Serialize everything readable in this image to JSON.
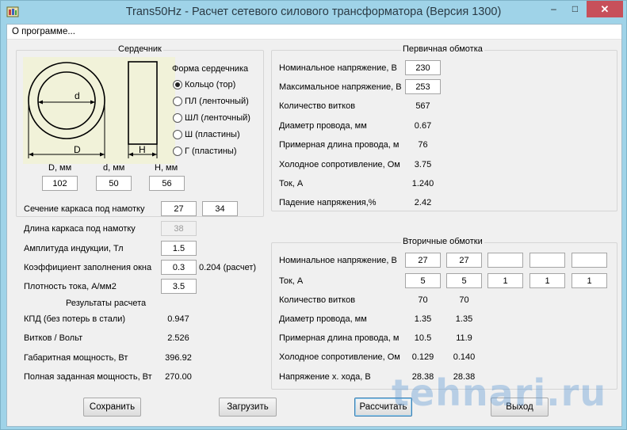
{
  "window": {
    "title": "Trans50Hz - Расчет сетевого силового трансформатора (Версия 1300)",
    "min": "–",
    "max": "□",
    "close": "✕"
  },
  "menu": {
    "about": "О программе..."
  },
  "core": {
    "group_title": "Сердечник",
    "shape_title": "Форма сердечника",
    "shapes": [
      "Кольцо  (тор)",
      "ПЛ  (ленточный)",
      "ШЛ  (ленточный)",
      "Ш  (пластины)",
      "Г (пластины)"
    ],
    "selected_shape": 0,
    "diagram": {
      "d": "d",
      "D": "D",
      "H": "H"
    },
    "dims": {
      "D_label": "D, мм",
      "d_label": "d, мм",
      "H_label": "H, мм",
      "D": "102",
      "d": "50",
      "H": "56"
    }
  },
  "params": {
    "section_label": "Сечение каркаса под намотку",
    "section1": "27",
    "section2": "34",
    "length_label": "Длина каркаса под намотку",
    "length": "38",
    "induction_label": "Амплитуда индукции, Тл",
    "induction": "1.5",
    "fill_label": "Коэффициент заполнения окна",
    "fill": "0.3",
    "fill_calc": "0.204 (расчет)",
    "density_label": "Плотность тока, А/мм2",
    "density": "3.5"
  },
  "results": {
    "title": "Результаты расчета",
    "rows": [
      {
        "label": "КПД (без потерь в стали)",
        "value": "0.947"
      },
      {
        "label": "Витков / Вольт",
        "value": "2.526"
      },
      {
        "label": "Габаритная мощность, Вт",
        "value": "396.92"
      },
      {
        "label": "Полная заданная мощность, Вт",
        "value": "270.00"
      }
    ]
  },
  "primary": {
    "title": "Первичная обмотка",
    "nominal_label": "Номинальное напряжение, В",
    "nominal": "230",
    "max_label": "Максимальное напряжение, В",
    "max": "253",
    "rows": [
      {
        "label": "Количество витков",
        "value": "567"
      },
      {
        "label": "Диаметр провода, мм",
        "value": "0.67"
      },
      {
        "label": "Примерная длина провода, м",
        "value": "76"
      },
      {
        "label": "Холодное сопротивление, Ом",
        "value": "3.75"
      },
      {
        "label": "Ток, А",
        "value": "1.240"
      },
      {
        "label": "Падение напряжения,%",
        "value": "2.42"
      }
    ]
  },
  "secondary": {
    "title": "Вторичные обмотки",
    "voltage_label": "Номинальное напряжение, В",
    "voltages": [
      "27",
      "27",
      "",
      "",
      ""
    ],
    "current_label": "Ток, А",
    "currents": [
      "5",
      "5",
      "1",
      "1",
      "1"
    ],
    "rows": [
      {
        "label": "Количество витков",
        "values": [
          "70",
          "70"
        ]
      },
      {
        "label": "Диаметр провода, мм",
        "values": [
          "1.35",
          "1.35"
        ]
      },
      {
        "label": "Примерная длина провода, м",
        "values": [
          "10.5",
          "11.9"
        ]
      },
      {
        "label": "Холодное сопротивление, Ом",
        "values": [
          "0.129",
          "0.140"
        ]
      },
      {
        "label": "Напряжение х. хода, В",
        "values": [
          "28.38",
          "28.38"
        ]
      }
    ]
  },
  "buttons": {
    "save": "Сохранить",
    "load": "Загрузить",
    "calc": "Рассчитать",
    "exit": "Выход"
  },
  "watermark": "tehnari.ru"
}
